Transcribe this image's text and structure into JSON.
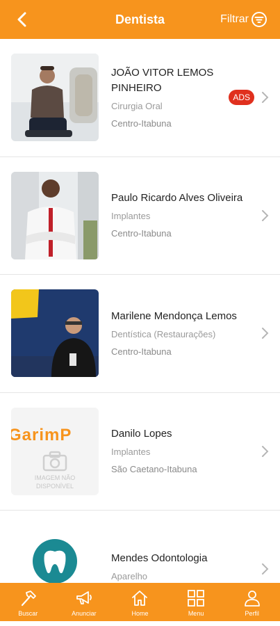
{
  "header": {
    "title": "Dentista",
    "filter_label": "Filtrar",
    "accent": "#f7941d"
  },
  "list": [
    {
      "name": "JOÃO VITOR LEMOS PINHEIRO",
      "specialty": "Cirurgia Oral",
      "location": "Centro-Itabuna",
      "badge": "ADS"
    },
    {
      "name": "Paulo Ricardo Alves Oliveira",
      "specialty": "Implantes",
      "location": "Centro-Itabuna"
    },
    {
      "name": "Marilene Mendonça Lemos",
      "specialty": "Dentística (Restaurações)",
      "location": "Centro-Itabuna"
    },
    {
      "name": "Danilo Lopes",
      "specialty": "Implantes",
      "location": "São Caetano-Itabuna",
      "placeholder_text_1": "IMAGEM NÃO",
      "placeholder_text_2": "DISPONÍVEL",
      "sign_text": "GarimP"
    },
    {
      "name": "Mendes Odontologia",
      "specialty": "Aparelho",
      "location": ""
    }
  ],
  "tabbar": [
    {
      "label": "Buscar",
      "icon": "hammer-icon"
    },
    {
      "label": "Anunciar",
      "icon": "megaphone-icon"
    },
    {
      "label": "Home",
      "icon": "home-icon"
    },
    {
      "label": "Menu",
      "icon": "grid-icon"
    },
    {
      "label": "Perfil",
      "icon": "person-icon"
    }
  ]
}
